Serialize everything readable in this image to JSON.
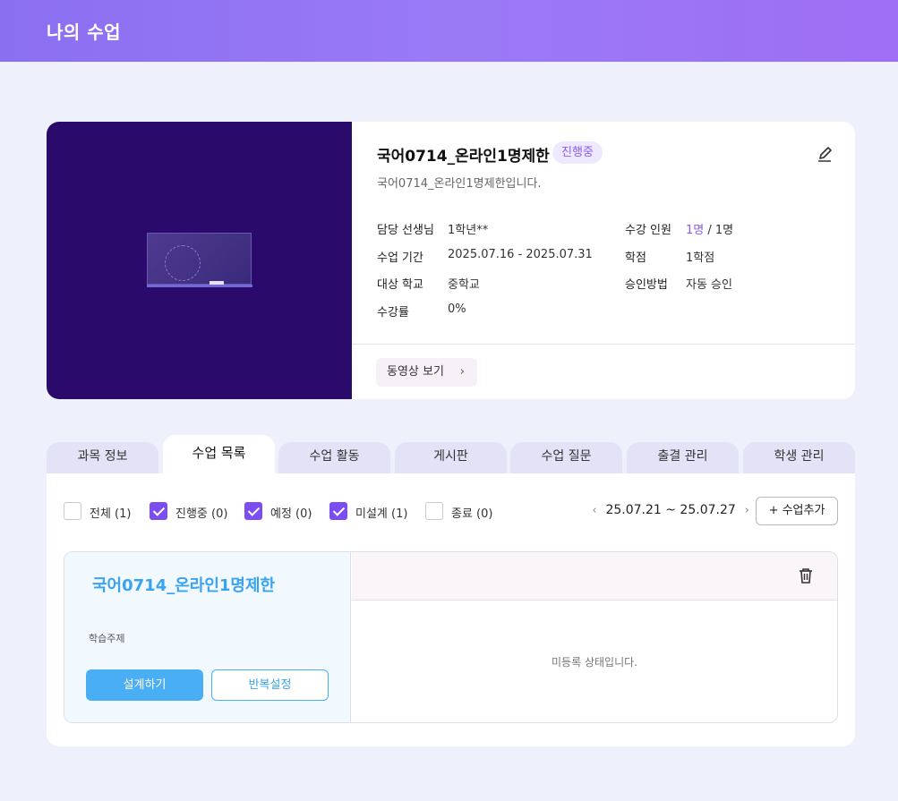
{
  "header": {
    "title": "나의 수업"
  },
  "course": {
    "name": "국어0714_온라인1명제한",
    "status": "진행중",
    "description": "국어0714_온라인1명제한입니다.",
    "meta": {
      "teacher_label": "담당 선생님",
      "teacher_value": "1학년**",
      "period_label": "수업 기간",
      "period_value": "2025.07.16 - 2025.07.31",
      "school_label": "대상 학교",
      "school_value": "중학교",
      "rate_label": "수강률",
      "rate_value": "0%",
      "enroll_label": "수강 인원",
      "enroll_current": "1명",
      "enroll_total": "/ 1명",
      "credit_label": "학점",
      "credit_value": "1학점",
      "approval_label": "승인방법",
      "approval_value": "자동 승인"
    },
    "video_button": "동영상 보기",
    "video_chevron": "›"
  },
  "tabs": [
    {
      "label": "과목 정보",
      "active": false
    },
    {
      "label": "수업 목록",
      "active": true
    },
    {
      "label": "수업 활동",
      "active": false
    },
    {
      "label": "게시판",
      "active": false
    },
    {
      "label": "수업 질문",
      "active": false
    },
    {
      "label": "출결 관리",
      "active": false
    },
    {
      "label": "학생 관리",
      "active": false
    }
  ],
  "filters": [
    {
      "label": "전체 (1)",
      "checked": false
    },
    {
      "label": "진행중 (0)",
      "checked": true
    },
    {
      "label": "예정 (0)",
      "checked": true
    },
    {
      "label": "미설계 (1)",
      "checked": true
    },
    {
      "label": "종료 (0)",
      "checked": false
    }
  ],
  "week": {
    "prev": "‹",
    "range": "25.07.21 ~ 25.07.27",
    "next": "›"
  },
  "add_lesson_button": "+ 수업추가",
  "lesson": {
    "title": "국어0714_온라인1명제한",
    "topic_label": "학습주제",
    "design_button": "설계하기",
    "repeat_button": "반복설정",
    "empty_message": "미등록 상태입니다."
  },
  "colors": {
    "accent": "#7c4df0",
    "lesson_blue": "#4aaef5",
    "header": "#8a6ff1"
  },
  "icons": {
    "edit": "pencil-icon",
    "delete": "trash-icon",
    "check": "check-icon"
  }
}
